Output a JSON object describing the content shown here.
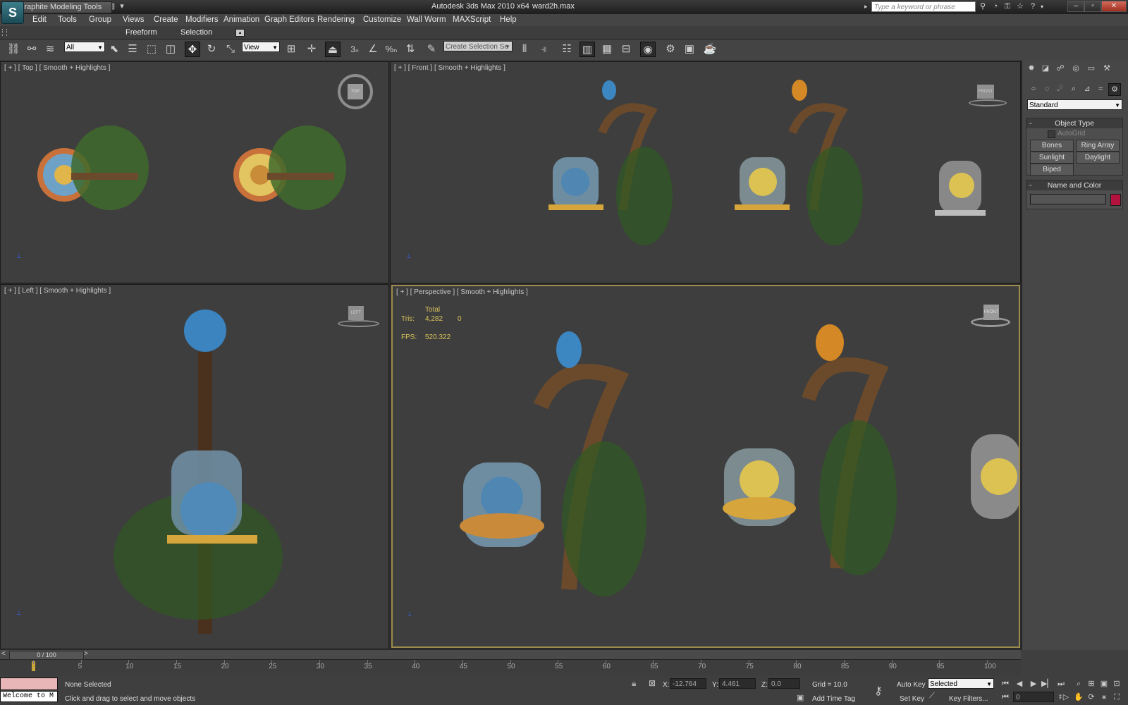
{
  "titlebar": {
    "title": "Autodesk 3ds Max  2010 x64",
    "file": "ward2h.max",
    "search_placeholder": "Type a keyword or phrase",
    "logo": "3ds-max-logo"
  },
  "menu": [
    "Edit",
    "Tools",
    "Group",
    "Views",
    "Create",
    "Modifiers",
    "Animation",
    "Graph Editors",
    "Rendering",
    "Customize",
    "Wall Worm",
    "MAXScript",
    "Help"
  ],
  "ribbon": {
    "tabs": [
      "Graphite Modeling Tools",
      "Freeform",
      "Selection"
    ]
  },
  "toolbar": {
    "filter_value": "All",
    "refcoord_value": "View",
    "selection_set_placeholder": "Create Selection Se"
  },
  "viewports": {
    "top": {
      "label": "[ + ] [ Top ] [ Smooth + Highlights ]",
      "cube": "TOP"
    },
    "front": {
      "label": "[ + ] [ Front ] [ Smooth + Highlights ]",
      "cube": "FRONT"
    },
    "left": {
      "label": "[ + ] [ Left ] [ Smooth + Highlights ]",
      "cube": "LEFT"
    },
    "perspective": {
      "label": "[ + ] [ Perspective ] [ Smooth + Highlights ]",
      "cube": "FRONT"
    }
  },
  "stats": {
    "total_label": "Total",
    "tris_label": "Tris:",
    "tris_value": "4,282",
    "tris_sel": "0",
    "fps_label": "FPS:",
    "fps_value": "520.322"
  },
  "command_panel": {
    "category_value": "Standard",
    "object_type_header": "Object Type",
    "autogrid": "AutoGrid",
    "buttons": [
      "Bones",
      "Ring Array",
      "Sunlight",
      "Daylight",
      "Biped"
    ],
    "name_color_header": "Name and Color",
    "swatch_color": "#b3123f"
  },
  "timeline": {
    "slider_label": "0 / 100",
    "ticks": [
      "0",
      "5",
      "10",
      "15",
      "20",
      "25",
      "30",
      "35",
      "40",
      "45",
      "50",
      "55",
      "60",
      "65",
      "70",
      "75",
      "80",
      "85",
      "90",
      "95",
      "100"
    ]
  },
  "status": {
    "listener": "Welcome to M",
    "selection": "None Selected",
    "prompt": "Click and drag to select and move objects",
    "x_label": "X:",
    "x_value": "-12.764",
    "y_label": "Y:",
    "y_value": "4.461",
    "z_label": "Z:",
    "z_value": "0.0",
    "grid": "Grid = 10.0",
    "add_time_tag": "Add Time Tag",
    "auto_key": "Auto Key",
    "set_key": "Set Key",
    "key_mode_value": "Selected",
    "key_filters": "Key Filters...",
    "frame_value": "0"
  },
  "colors": {
    "accent_active_border": "#9d8c4d",
    "stats_text": "#d8c25a"
  }
}
